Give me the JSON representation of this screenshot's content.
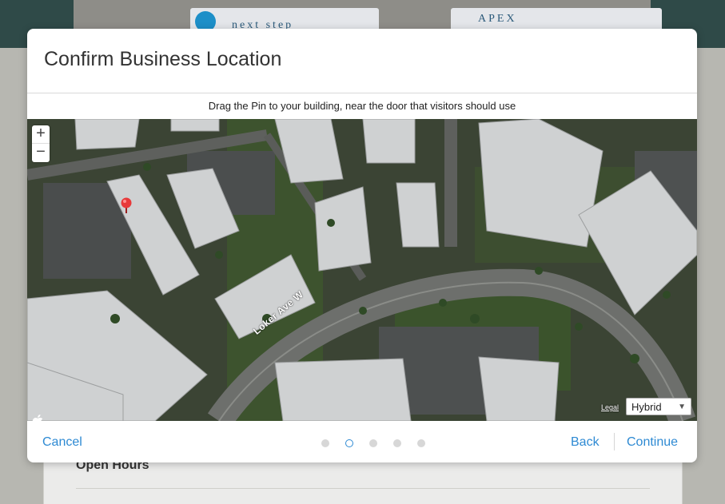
{
  "background": {
    "card_left_text": "next step",
    "card_right_text": "APEX",
    "section_heading": "Open Hours"
  },
  "modal": {
    "title": "Confirm Business Location",
    "instruction": "Drag the Pin to your building, near the door that visitors should use",
    "map": {
      "zoom_in": "+",
      "zoom_out": "−",
      "street_label": "Loker Ave W",
      "legal_link": "Legal",
      "map_type": "Hybrid",
      "map_type_options": [
        "Hybrid"
      ],
      "pin_color": "#e8393a"
    },
    "footer": {
      "cancel": "Cancel",
      "back": "Back",
      "continue": "Continue",
      "steps_total": 5,
      "current_step": 2
    },
    "accent_color": "#2e8ad3"
  }
}
